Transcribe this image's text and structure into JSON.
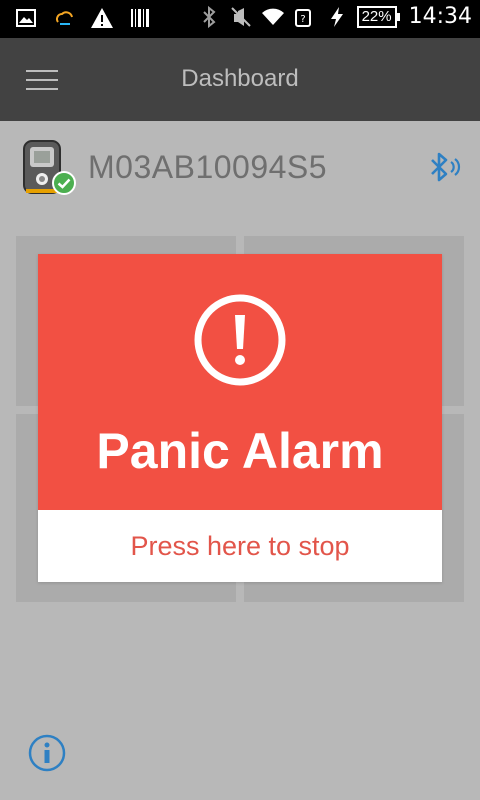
{
  "status_bar": {
    "battery_percent": "22%",
    "time": "14:34",
    "icons": [
      "image-icon",
      "weather-icon",
      "warning-icon",
      "barcode-icon",
      "bluetooth-icon",
      "vibrate-off-icon",
      "wifi-icon",
      "signal-icon",
      "charging-icon",
      "battery-icon"
    ]
  },
  "header": {
    "title": "Dashboard",
    "menu_icon": "hamburger-menu-icon"
  },
  "device": {
    "name": "M03AB10094S5",
    "status": "connected",
    "bluetooth_icon": "bluetooth-icon"
  },
  "alarm": {
    "title": "Panic Alarm",
    "action_label": "Press here to stop",
    "icon": "exclamation-icon",
    "header_color": "#f25043"
  },
  "footer": {
    "info_icon": "info-icon"
  },
  "colors": {
    "accent_blue": "#2e80c3",
    "alarm_red": "#f25043",
    "success_green": "#4caf50"
  }
}
